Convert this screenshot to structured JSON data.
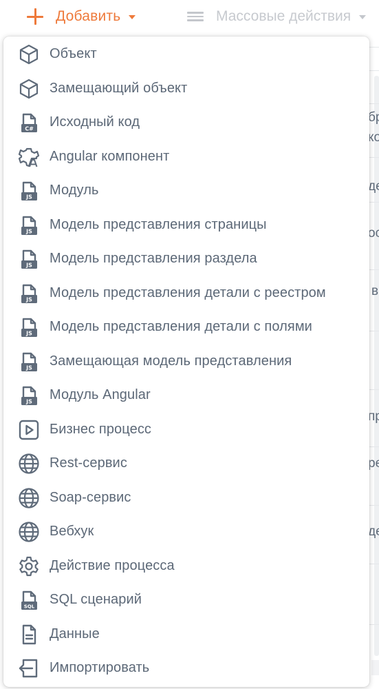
{
  "toolbar": {
    "add_label": "Добавить",
    "add_color": "#EE7A3B",
    "mass_actions_label": "Массовые действия",
    "mass_actions_color": "#C7CACF"
  },
  "background": {
    "fragments": [
      "бр",
      "ко",
      "де",
      "ос",
      "в",
      "пр",
      "ре",
      "де"
    ]
  },
  "menu": {
    "text_color": "#5C6877",
    "icon_color": "#5F6B7A",
    "items": [
      {
        "label": "Объект",
        "icon": "cube-icon"
      },
      {
        "label": "Замещающий объект",
        "icon": "cube-icon"
      },
      {
        "label": "Исходный код",
        "icon": "csharp-file-icon"
      },
      {
        "label": "Angular компонент",
        "icon": "angular-component-icon"
      },
      {
        "label": "Модуль",
        "icon": "js-file-icon"
      },
      {
        "label": "Модель представления страницы",
        "icon": "js-file-icon"
      },
      {
        "label": "Модель представления раздела",
        "icon": "js-file-icon"
      },
      {
        "label": "Модель представления детали с реестром",
        "icon": "js-file-icon"
      },
      {
        "label": "Модель представления детали с полями",
        "icon": "js-file-icon"
      },
      {
        "label": "Замещающая модель представления",
        "icon": "js-file-icon"
      },
      {
        "label": "Модуль Angular",
        "icon": "js-file-icon"
      },
      {
        "label": "Бизнес процесс",
        "icon": "play-icon"
      },
      {
        "label": "Rest-сервис",
        "icon": "globe-icon"
      },
      {
        "label": "Soap-сервис",
        "icon": "globe-icon"
      },
      {
        "label": "Вебхук",
        "icon": "globe-icon"
      },
      {
        "label": "Действие процесса",
        "icon": "gear-icon"
      },
      {
        "label": "SQL сценарий",
        "icon": "sql-file-icon"
      },
      {
        "label": "Данные",
        "icon": "document-icon"
      },
      {
        "label": "Импортировать",
        "icon": "import-icon"
      }
    ]
  }
}
